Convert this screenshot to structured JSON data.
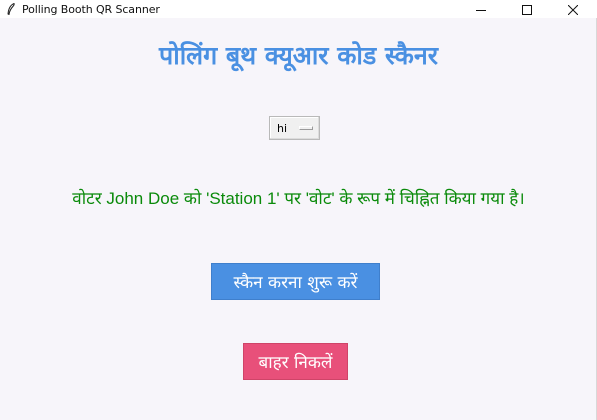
{
  "window": {
    "title": "Polling Booth QR Scanner",
    "app_icon": "feather-icon",
    "controls": {
      "minimize_icon": "minimize-icon",
      "maximize_icon": "maximize-icon",
      "close_icon": "close-icon"
    }
  },
  "main": {
    "heading": "पोलिंग बूथ क्यूआर कोड स्कैनर",
    "language_select": {
      "selected": "hi"
    },
    "status_message": "वोटर John Doe को 'Station 1' पर 'वोट' के रूप में चिह्नित किया गया है।",
    "scan_button": "स्कैन करना शुरू करें",
    "exit_button": "बाहर निकलें"
  },
  "colors": {
    "heading": "#4a90e2",
    "status": "#0a8a0a",
    "scan_button_bg": "#4a90e2",
    "exit_button_bg": "#e8507a",
    "background": "#f7f5fa"
  }
}
